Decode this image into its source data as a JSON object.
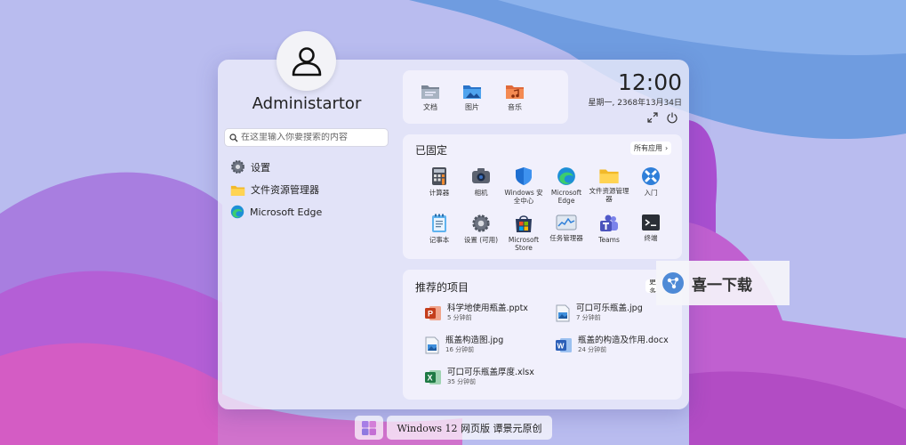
{
  "user": {
    "name": "Administartor"
  },
  "search": {
    "placeholder": "在这里输入你要搜索的内容"
  },
  "quick_links": [
    {
      "label": "设置",
      "icon": "gear-icon"
    },
    {
      "label": "文件资源管理器",
      "icon": "folder-icon"
    },
    {
      "label": "Microsoft Edge",
      "icon": "edge-icon"
    }
  ],
  "folders": [
    {
      "label": "文档",
      "icon": "documents-folder-icon"
    },
    {
      "label": "图片",
      "icon": "pictures-folder-icon"
    },
    {
      "label": "音乐",
      "icon": "music-folder-icon"
    }
  ],
  "clock": {
    "time": "12:00",
    "date": "星期一, 2368年13月34日"
  },
  "pinned": {
    "title": "已固定",
    "all_apps": "所有应用",
    "apps": [
      {
        "label": "计算器",
        "icon": "calculator-icon"
      },
      {
        "label": "相机",
        "icon": "camera-icon"
      },
      {
        "label": "Windows 安全中心",
        "icon": "shield-icon"
      },
      {
        "label": "Microsoft Edge",
        "icon": "edge-icon"
      },
      {
        "label": "文件资源管理器",
        "icon": "folder-icon"
      },
      {
        "label": "入门",
        "icon": "tips-icon"
      },
      {
        "label": "记事本",
        "icon": "notepad-icon"
      },
      {
        "label": "设置 (可用)",
        "icon": "gear-icon"
      },
      {
        "label": "Microsoft Store",
        "icon": "store-icon"
      },
      {
        "label": "任务管理器",
        "icon": "task-manager-icon"
      },
      {
        "label": "Teams",
        "icon": "teams-icon"
      },
      {
        "label": "终端",
        "icon": "terminal-icon"
      }
    ]
  },
  "recommended": {
    "title": "推荐的项目",
    "more": "更多",
    "items": [
      {
        "name": "科学地使用瓶盖.pptx",
        "time": "5 分钟前",
        "icon": "powerpoint-icon"
      },
      {
        "name": "可口可乐瓶盖.jpg",
        "time": "7 分钟前",
        "icon": "image-file-icon"
      },
      {
        "name": "瓶盖构造图.jpg",
        "time": "16 分钟前",
        "icon": "image-file-icon"
      },
      {
        "name": "瓶盖的构造及作用.docx",
        "time": "24 分钟前",
        "icon": "word-icon"
      },
      {
        "name": "可口可乐瓶盖厚度.xlsx",
        "time": "35 分钟前",
        "icon": "excel-icon"
      }
    ]
  },
  "watermark": {
    "text": "喜一下载"
  },
  "taskbar": {
    "label": "Windows 12 网页版 谭景元原创"
  }
}
